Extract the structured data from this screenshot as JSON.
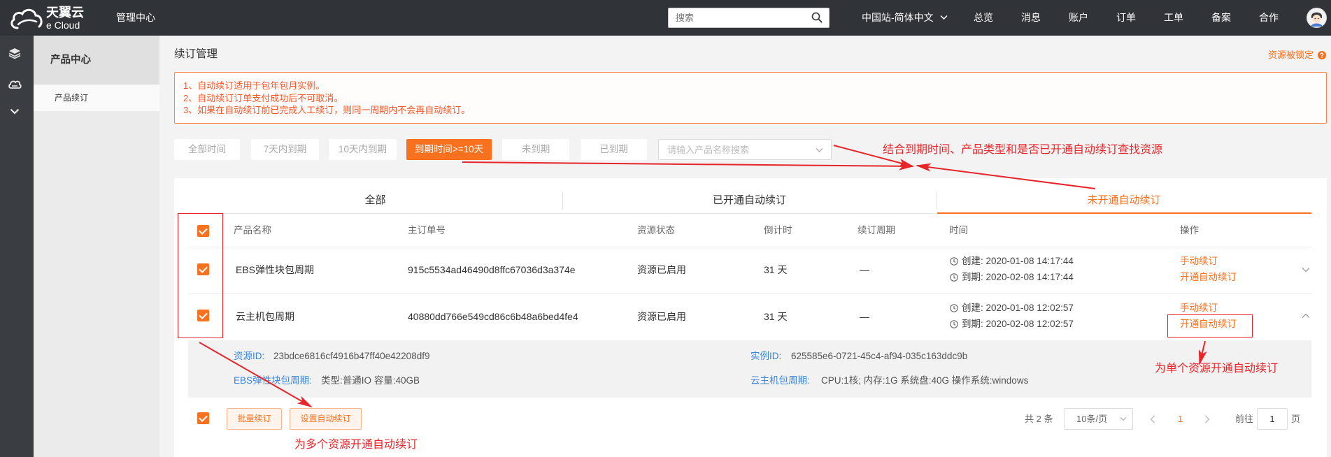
{
  "topbar": {
    "logo_cn": "天翼云",
    "logo_en": "e Cloud",
    "title": "管理中心",
    "search_placeholder": "搜索",
    "region": "中国站-简体中文",
    "nav": [
      "总览",
      "消息",
      "账户",
      "订单",
      "工单",
      "备案",
      "合作"
    ]
  },
  "rail": {
    "icons": [
      "layers-icon",
      "cloud-disk-icon",
      "chevron-down-icon"
    ]
  },
  "sidebar": {
    "section": "产品中心",
    "items": [
      {
        "label": "产品续订",
        "selected": true
      }
    ]
  },
  "page": {
    "title": "续订管理",
    "lock_link": "资源被锁定",
    "notices": [
      "1、自动续订适用于包年包月实例。",
      "2、自动续订订单支付成功后不可取消。",
      "3、如果在自动续订前已完成人工续订，则同一周期内不会再自动续订。"
    ]
  },
  "filters": {
    "buttons": [
      "全部时间",
      "7天内到期",
      "10天内到期",
      "到期时间>=10天",
      "未到期",
      "已到期"
    ],
    "active_index": 3,
    "search_placeholder": "请输入产品名称搜索"
  },
  "tabs": {
    "items": [
      "全部",
      "已开通自动续订",
      "未开通自动续订"
    ],
    "active_index": 2
  },
  "table": {
    "select_all_checked": true,
    "columns": [
      "产品名称",
      "主订单号",
      "资源状态",
      "倒计时",
      "续订周期",
      "时间",
      "操作"
    ],
    "rows": [
      {
        "checked": true,
        "expanded": false,
        "name": "EBS弹性块包周期",
        "order_id": "915c5534ad46490d8ffc67036d3a374e",
        "status": "资源已启用",
        "countdown": "31 天",
        "period": "—",
        "created": "创建: 2020-01-08 14:17:44",
        "expires": "到期: 2020-02-08 14:17:44",
        "actions": [
          "手动续订",
          "开通自动续订"
        ]
      },
      {
        "checked": true,
        "expanded": true,
        "name": "云主机包周期",
        "order_id": "40880dd766e549cd86c6b48a6bed4fe4",
        "status": "资源已启用",
        "countdown": "31 天",
        "period": "—",
        "created": "创建: 2020-01-08 12:02:57",
        "expires": "到期: 2020-02-08 12:02:57",
        "actions": [
          "手动续订",
          "开通自动续订"
        ]
      }
    ]
  },
  "detail": {
    "resource_id_label": "资源ID:",
    "resource_id": "23bdce6816cf4916b47ff40e42208df9",
    "instance_id_label": "实例ID:",
    "instance_id": "625585e6-0721-45c4-af94-035c163ddc9b",
    "ebs_label": "EBS弹性块包周期:",
    "ebs_value": "类型:普通IO 容量:40GB",
    "vm_label": "云主机包周期:",
    "vm_value": "CPU:1核; 内存:1G 系统盘:40G 操作系统:windows"
  },
  "footer": {
    "select_all_checked": true,
    "batch_renew": "批量续订",
    "set_auto_renew": "设置自动续订",
    "total": "共 2 条",
    "page_size": "10条/页",
    "current_page": "1",
    "goto_label": "前往",
    "goto_value": "1",
    "page_unit": "页"
  },
  "annotations": {
    "find": "结合到期时间、产品类型和是否已开通自动续订查找资源",
    "single": "为单个资源开通自动续订",
    "multi": "为多个资源开通自动续订"
  },
  "colors": {
    "topbar": "#303338",
    "accent": "#f7711f",
    "link_blue": "#3d86d8",
    "annotation_red": "#e8262a"
  }
}
